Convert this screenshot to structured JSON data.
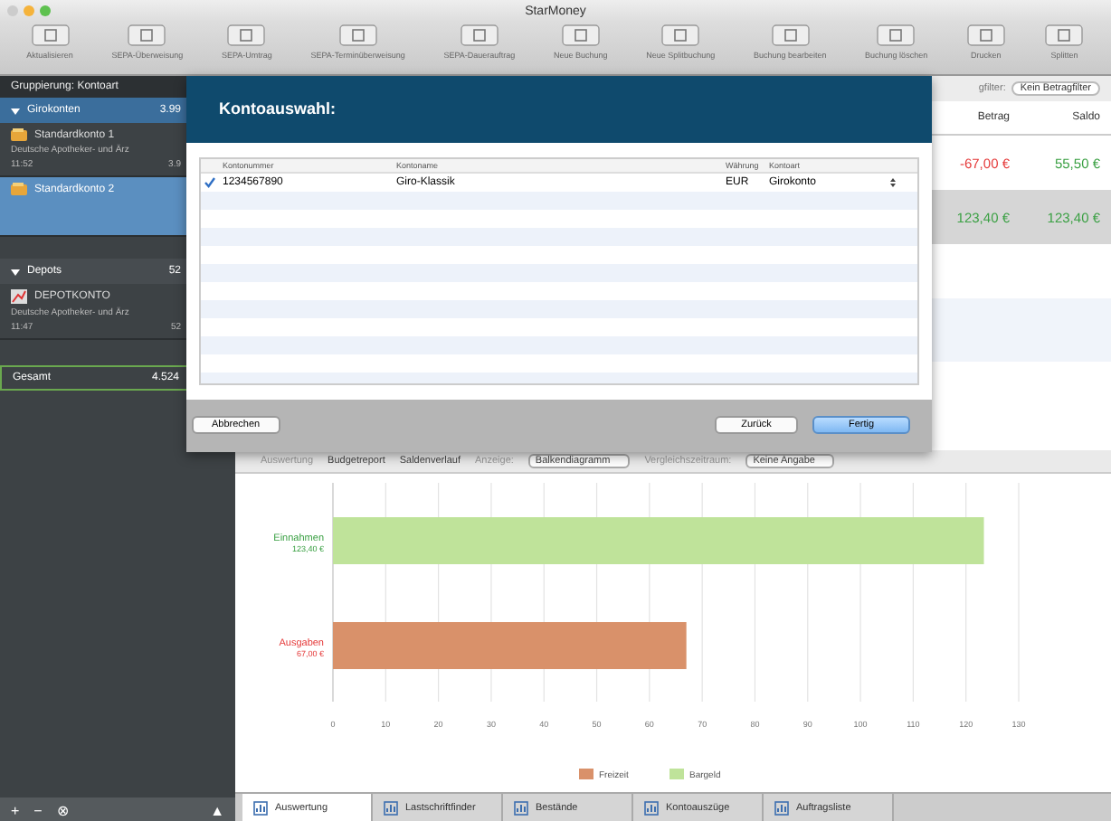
{
  "window": {
    "title": "StarMoney"
  },
  "toolbar": [
    {
      "label": "Aktualisieren"
    },
    {
      "label": "SEPA-Überweisung"
    },
    {
      "label": "SEPA-Umtrag"
    },
    {
      "label": "SEPA-Terminüberweisung"
    },
    {
      "label": "SEPA-Dauerauftrag"
    },
    {
      "label": "Neue Buchung"
    },
    {
      "label": "Neue Splitbuchung"
    },
    {
      "label": "Buchung bearbeiten"
    },
    {
      "label": "Buchung löschen"
    },
    {
      "label": "Drucken"
    },
    {
      "label": "Splitten"
    }
  ],
  "sidebar": {
    "header": "Gruppierung: Kontoart",
    "groups": [
      {
        "name": "Girokonten",
        "total": "3.99",
        "expanded": true,
        "accounts": [
          {
            "name": "Standardkonto 1",
            "bank": "Deutsche Apotheker- und Ärz",
            "time": "11:52",
            "balance": "3.9",
            "selected": false,
            "kind": "giro"
          },
          {
            "name": "Standardkonto 2",
            "selected": true,
            "kind": "giro"
          }
        ]
      },
      {
        "name": "Depots",
        "total": "52",
        "expanded": true,
        "accounts": [
          {
            "name": "DEPOTKONTO",
            "bank": "Deutsche Apotheker- und Ärz",
            "time": "11:47",
            "balance": "52",
            "selected": false,
            "kind": "depot"
          }
        ]
      }
    ],
    "total_label": "Gesamt",
    "total": "4.524",
    "footer_buttons": [
      "+",
      "−",
      "⊗",
      "▲"
    ]
  },
  "bookings": {
    "filter_label": "gfilter:",
    "filter_value": "Kein Betragfilter",
    "columns": [
      "Betrag",
      "Saldo"
    ],
    "rows": [
      {
        "cells": [
          "-67,00 €",
          "55,50 €"
        ],
        "selected": false
      },
      {
        "cells": [
          "123,40 €",
          "123,40 €"
        ],
        "selected": true
      }
    ]
  },
  "dialog": {
    "title": "Kontoauswahl:",
    "columns": [
      "Kontonummer",
      "Kontoname",
      "Währung",
      "Kontoart"
    ],
    "rows": [
      {
        "checked": true,
        "number": "1234567890",
        "name": "Giro-Klassik",
        "currency": "EUR",
        "type": "Girokonto"
      }
    ],
    "buttons": [
      {
        "label": "Abbrechen",
        "kind": "default"
      },
      {
        "label": "Zurück",
        "kind": "default"
      },
      {
        "label": "Fertig",
        "kind": "primary"
      }
    ]
  },
  "report_bar": {
    "items": [
      {
        "label": "Auswertung",
        "kind": "label"
      },
      {
        "label": "Budgetreport",
        "kind": "text"
      },
      {
        "label": "Saldenverlauf",
        "kind": "text"
      },
      {
        "label": "Anzeige:",
        "kind": "label"
      },
      {
        "label": "Balkendiagramm",
        "kind": "select"
      },
      {
        "label": "Vergleichszeitraum:",
        "kind": "label"
      },
      {
        "label": "Keine Angabe",
        "kind": "select"
      }
    ]
  },
  "chart": {
    "chart_data": {
      "type": "bar",
      "orientation": "horizontal",
      "stacked": true,
      "categories": [
        "Einnahmen",
        "Ausgaben"
      ],
      "value_labels": [
        "123,40 €",
        "67,00 €"
      ],
      "grid": true,
      "legend": "bottom",
      "series": [
        {
          "name": "Freizeit",
          "color": "#d9916a",
          "values": [
            null,
            67.0
          ]
        },
        {
          "name": "Bargeld",
          "color": "#bfe39a",
          "values": [
            123.4,
            null
          ]
        }
      ],
      "xlim": [
        0,
        130
      ],
      "xticks": [
        0,
        10,
        20,
        30,
        40,
        50,
        60,
        70,
        80,
        90,
        100,
        110,
        120,
        130
      ]
    }
  },
  "tabs": [
    {
      "label": "Auswertung",
      "selected": true
    },
    {
      "label": "Lastschriftfinder",
      "selected": false
    },
    {
      "label": "Bestände",
      "selected": false
    },
    {
      "label": "Kontoauszüge",
      "selected": false
    },
    {
      "label": "Auftragsliste",
      "selected": false
    }
  ]
}
